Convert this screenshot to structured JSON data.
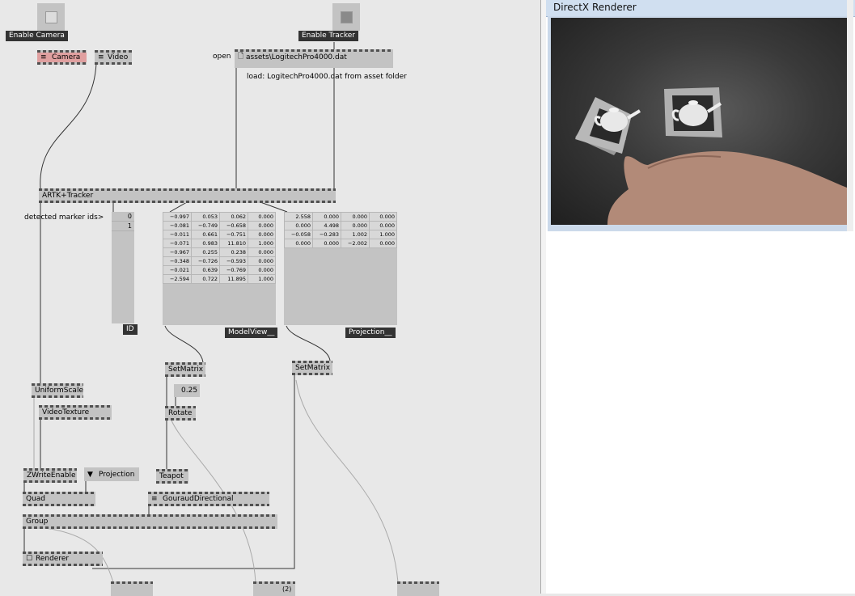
{
  "patch": {
    "enable_camera": "Enable Camera",
    "enable_tracker": "Enable Tracker",
    "camera_node": "Camera",
    "video_node": "Video",
    "open_label": "open",
    "file_path": "assets\\LogitechPro4000.dat",
    "load_comment": "load: LogitechPro4000.dat from asset folder",
    "artk_tracker": "ARTK+Tracker",
    "detected_label": "detected marker ids>",
    "marker_ids": [
      "0",
      "1"
    ],
    "id_label": "ID",
    "modelview_label": "ModelView__",
    "projection_label": "Projection__",
    "modelview_matrix": [
      [
        "−0.997",
        "0.053",
        "0.062",
        "0.000"
      ],
      [
        "−0.081",
        "−0.749",
        "−0.658",
        "0.000"
      ],
      [
        "−0.011",
        "0.661",
        "−0.751",
        "0.000"
      ],
      [
        "−0.071",
        "0.983",
        "11.810",
        "1.000"
      ],
      [
        "−0.967",
        "0.255",
        "0.238",
        "0.000"
      ],
      [
        "−0.348",
        "−0.726",
        "−0.593",
        "0.000"
      ],
      [
        "−0.021",
        "0.639",
        "−0.769",
        "0.000"
      ],
      [
        "−2.594",
        "0.722",
        "11.895",
        "1.000"
      ]
    ],
    "projection_matrix": [
      [
        "2.558",
        "0.000",
        "0.000",
        "0.000"
      ],
      [
        "0.000",
        "4.498",
        "0.000",
        "0.000"
      ],
      [
        "−0.058",
        "−0.283",
        "1.002",
        "1.000"
      ],
      [
        "0.000",
        "0.000",
        "−2.002",
        "0.000"
      ]
    ],
    "setmatrix_1": "SetMatrix",
    "setmatrix_2": "SetMatrix",
    "value_025": "0.25",
    "rotate": "Rotate",
    "uniform_scale": "UniformScale",
    "video_texture": "VideoTexture",
    "zwrite_enable": "ZWriteEnable",
    "projection_enum": "Projection",
    "teapot": "Teapot",
    "quad": "Quad",
    "gouraud": "GouraudDirectional",
    "group": "Group",
    "renderer": "Renderer",
    "bottom_node_2": "(2)"
  },
  "window": {
    "title": "DirectX Renderer"
  },
  "colors": {
    "patch_bg": "#e8e8e8",
    "node_bg": "#c3c3c3",
    "camera_node_bg": "#e0a0a0",
    "label_dark": "#333333",
    "titlebar": "#d0dff0"
  }
}
